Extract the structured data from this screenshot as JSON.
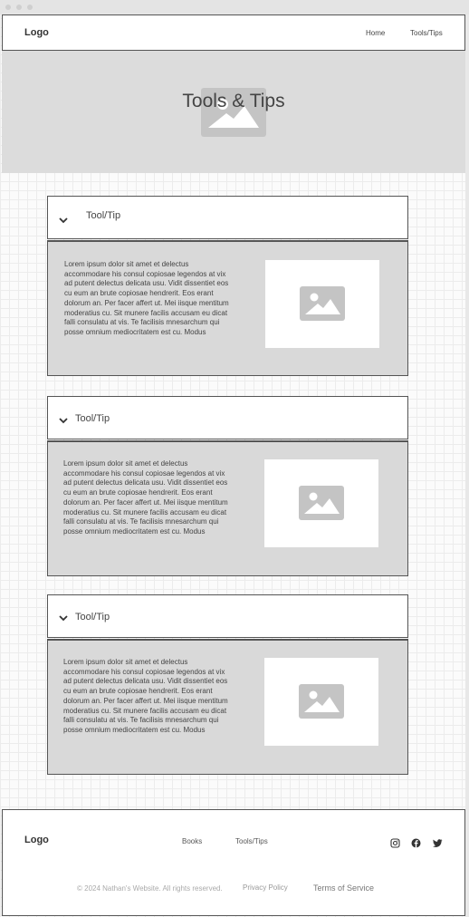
{
  "header": {
    "logo": "Logo",
    "nav": [
      "Home",
      "Tools/Tips"
    ]
  },
  "hero": {
    "title": "Tools & Tips",
    "image_icon": "image-placeholder-icon"
  },
  "sections": [
    {
      "title": "Tool/Tip",
      "expanded": true,
      "icon": "chevron-down-icon",
      "body": "Lorem ipsum dolor sit amet et delectus accommodare his consul copiosae legendos at vix ad putent delectus delicata usu. Vidit dissentiet eos cu eum an brute copiosae hendrerit. Eos erant dolorum an. Per facer affert ut. Mei iisque mentitum moderatius cu. Sit munere facilis accusam eu dicat falli consulatu at vis. Te facilisis mnesarchum qui posse omnium mediocritatem est cu. Modus",
      "image_icon": "image-placeholder-icon"
    },
    {
      "title": "Tool/Tip",
      "expanded": true,
      "icon": "chevron-down-icon",
      "body": "Lorem ipsum dolor sit amet et delectus accommodare his consul copiosae legendos at vix ad putent delectus delicata usu. Vidit dissentiet eos cu eum an brute copiosae hendrerit. Eos erant dolorum an. Per facer affert ut. Mei iisque mentitum moderatius cu. Sit munere facilis accusam eu dicat falli consulatu at vis. Te facilisis mnesarchum qui posse omnium mediocritatem est cu. Modus",
      "image_icon": "image-placeholder-icon"
    },
    {
      "title": "Tool/Tip",
      "expanded": true,
      "icon": "chevron-down-icon",
      "body": "Lorem ipsum dolor sit amet et delectus accommodare his consul copiosae legendos at vix ad putent delectus delicata usu. Vidit dissentiet eos cu eum an brute copiosae hendrerit. Eos erant dolorum an. Per facer affert ut. Mei iisque mentitum moderatius cu. Sit munere facilis accusam eu dicat falli consulatu at vis. Te facilisis mnesarchum qui posse omnium mediocritatem est cu. Modus",
      "image_icon": "image-placeholder-icon"
    }
  ],
  "footer": {
    "logo": "Logo",
    "links": [
      "Books",
      "Tools/Tips"
    ],
    "social_icons": [
      "instagram-icon",
      "facebook-icon",
      "twitter-icon"
    ],
    "copyright": "© 2024 Nathan's Website. All rights reserved.",
    "privacy": "Privacy Policy",
    "terms": "Terms of Service"
  },
  "colors": {
    "hero_bg": "#dcdcdc",
    "panel_bg": "#d9d9d9",
    "placeholder": "#c4c4c4",
    "border": "#555555"
  }
}
